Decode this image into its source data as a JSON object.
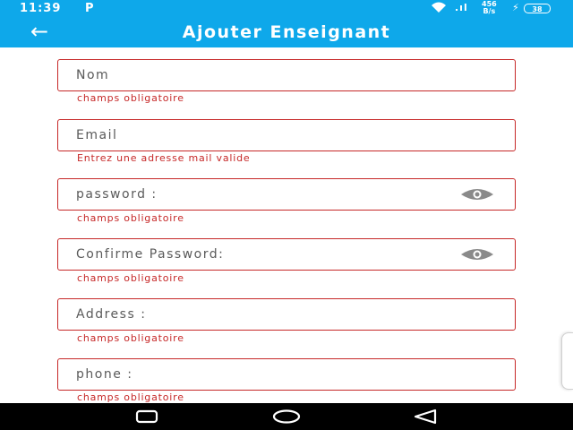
{
  "status_bar": {
    "time": "11:39",
    "app_icon": "P",
    "signal": ".ıl",
    "speed_value": "456",
    "speed_unit": "B/s",
    "battery": "38"
  },
  "app_bar": {
    "back_icon": "←",
    "title": "Ajouter Enseignant"
  },
  "form": {
    "fields": [
      {
        "placeholder": "Nom",
        "error": "champs obligatoire"
      },
      {
        "placeholder": "Email",
        "error": "Entrez une adresse mail valide"
      },
      {
        "placeholder": "password :",
        "error": "champs obligatoire"
      },
      {
        "placeholder": "Confirme Password:",
        "error": "champs obligatoire"
      },
      {
        "placeholder": "Address :",
        "error": "champs obligatoire"
      },
      {
        "placeholder": "phone :",
        "error": "champs obligatoire"
      }
    ]
  },
  "colors": {
    "primary": "#0ea8ea",
    "error": "#c62828",
    "nav_bar": "#000000"
  },
  "icons": {
    "back": "arrow-left-icon",
    "visibility": "eye-icon",
    "nav_recent": "square-icon",
    "nav_home": "circle-icon",
    "nav_back": "triangle-icon"
  }
}
